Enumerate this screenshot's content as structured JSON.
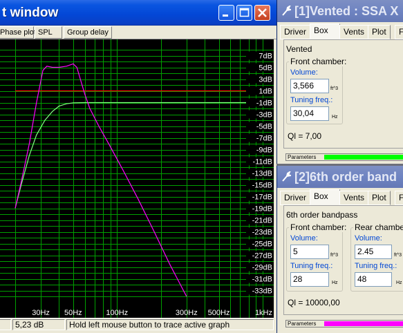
{
  "graph_window": {
    "title": "t window",
    "tabs": [
      "Phase plot",
      "SPL",
      "Group delay"
    ],
    "y_tick_labels": [
      "7dB",
      "5dB",
      "3dB",
      "1dB",
      "-1dB",
      "-3dB",
      "-5dB",
      "-7dB",
      "-9dB",
      "-11dB",
      "-13dB",
      "-15dB",
      "-17dB",
      "-19dB",
      "-21dB",
      "-23dB",
      "-25dB",
      "-27dB",
      "-29dB",
      "-31dB",
      "-33dB"
    ],
    "x_tick_labels": [
      "30Hz",
      "50Hz",
      "100Hz",
      "300Hz",
      "500Hz",
      "1kHz"
    ],
    "status": {
      "value": "5,23 dB",
      "hint": "Hold left mouse button to trace active graph"
    },
    "colors": {
      "background": "#000000",
      "grid": "#00a000",
      "active_curve": "#ff00ff",
      "secondary_curve": "#80ff80",
      "reference_line": "#ff0000"
    }
  },
  "chart_data": {
    "type": "line",
    "xlabel": "",
    "ylabel": "",
    "x_scale": "log",
    "xlim": [
      20,
      1000
    ],
    "ylim": [
      -34,
      8
    ],
    "grid": true,
    "series": [
      {
        "color": "#ff00ff",
        "x": [
          20,
          22,
          25,
          28,
          31,
          33,
          36,
          40,
          45,
          50,
          53,
          56,
          60,
          65,
          75,
          90,
          110,
          140,
          180,
          230,
          300
        ],
        "y": [
          -19,
          -14.5,
          -8,
          -1,
          4.5,
          5.2,
          5.0,
          5.0,
          5.2,
          5.6,
          5.0,
          3.0,
          0.5,
          -2,
          -5,
          -8.5,
          -12.5,
          -17.5,
          -23,
          -28.5,
          -34
        ]
      },
      {
        "color": "#80ff80",
        "x": [
          20,
          22,
          25,
          28,
          32,
          36,
          40,
          45,
          50,
          60,
          80,
          100,
          150,
          200,
          300,
          500,
          1000
        ],
        "y": [
          -19,
          -15,
          -10,
          -6.5,
          -4,
          -2.5,
          -1.6,
          -1.2,
          -1.05,
          -1.0,
          -1.0,
          -1.0,
          -1.0,
          -1.0,
          -1.0,
          -1.0,
          -1.0
        ]
      },
      {
        "color": "#ff0000",
        "x": [
          20,
          1000
        ],
        "y": [
          1,
          1
        ]
      }
    ]
  },
  "box1": {
    "title": "[1]Vented : SSA X",
    "tabs": [
      "Driver",
      "Box",
      "Vents",
      "Plot",
      "F"
    ],
    "active_tab": "Box",
    "type": "Vented",
    "front_chamber_label": "Front chamber:",
    "volume_label": "Volume:",
    "volume_value": "3,566",
    "volume_unit": "ft^3",
    "tuning_label": "Tuning freq.:",
    "tuning_value": "30,04",
    "tuning_unit": "Hz",
    "ql": "Ql = 7,00",
    "params_label": "Parameters",
    "params_color": "#00ff00"
  },
  "box2": {
    "title": "[2]6th order band",
    "tabs": [
      "Driver",
      "Box",
      "Vents",
      "Plot",
      "F"
    ],
    "active_tab": "Box",
    "type": "6th order bandpass",
    "front_chamber_label": "Front chamber:",
    "rear_chamber_label": "Rear chamber:",
    "front_volume_label": "Volume:",
    "front_volume_value": "5",
    "front_volume_unit": "ft^3",
    "front_tuning_label": "Tuning freq.:",
    "front_tuning_value": "28",
    "front_tuning_unit": "Hz",
    "rear_volume_label": "Volume:",
    "rear_volume_value": "2.45",
    "rear_volume_unit": "ft^3",
    "rear_tuning_label": "Tuning freq.:",
    "rear_tuning_value": "48",
    "rear_tuning_unit": "Hz",
    "ql": "Ql = 10000,00",
    "params_label": "Parameters",
    "params_color": "#ff00ff"
  }
}
